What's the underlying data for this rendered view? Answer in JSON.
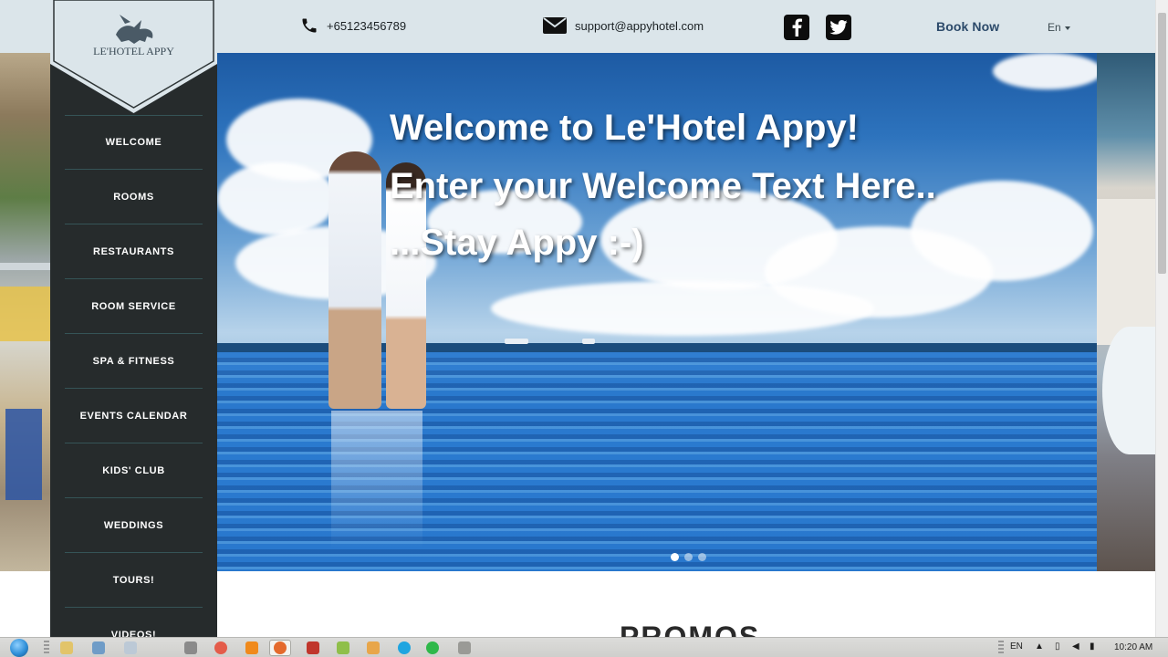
{
  "header": {
    "phone": "+65123456789",
    "email": "support@appyhotel.com",
    "book_now": "Book Now",
    "language": "En"
  },
  "brand": {
    "name": "LE'HOTEL APPY",
    "logo_icon": "pegasus-icon"
  },
  "sidebar": {
    "items": [
      {
        "label": "WELCOME"
      },
      {
        "label": "ROOMS"
      },
      {
        "label": "RESTAURANTS"
      },
      {
        "label": "ROOM SERVICE"
      },
      {
        "label": "SPA & FITNESS"
      },
      {
        "label": "EVENTS CALENDAR"
      },
      {
        "label": "KIDS' CLUB"
      },
      {
        "label": "WEDDINGS"
      },
      {
        "label": "TOURS!"
      },
      {
        "label": "VIDEOS!"
      }
    ]
  },
  "hero": {
    "line1": "Welcome to Le'Hotel Appy!",
    "line2": "Enter your Welcome Text Here..",
    "line3": "...Stay Appy :-)",
    "slides_total": 3,
    "active_slide": 1
  },
  "section": {
    "promos_title": "PROMOS"
  },
  "taskbar": {
    "lang": "EN",
    "clock": "10:20 AM",
    "apps": [
      "folder-icon",
      "explorer-icon",
      "notepad-icon",
      "tool-icon",
      "chrome-icon",
      "vlc-icon",
      "firefox-icon",
      "filezilla-icon",
      "notepadpp-icon",
      "grid-app-icon",
      "skype-icon",
      "line-icon",
      "chat-icon"
    ]
  },
  "colors": {
    "sidebar_bg": "#262b2c",
    "topbar_bg": "#dbe5ea",
    "accent_link": "#2c4a6a",
    "divider": "#355457"
  }
}
